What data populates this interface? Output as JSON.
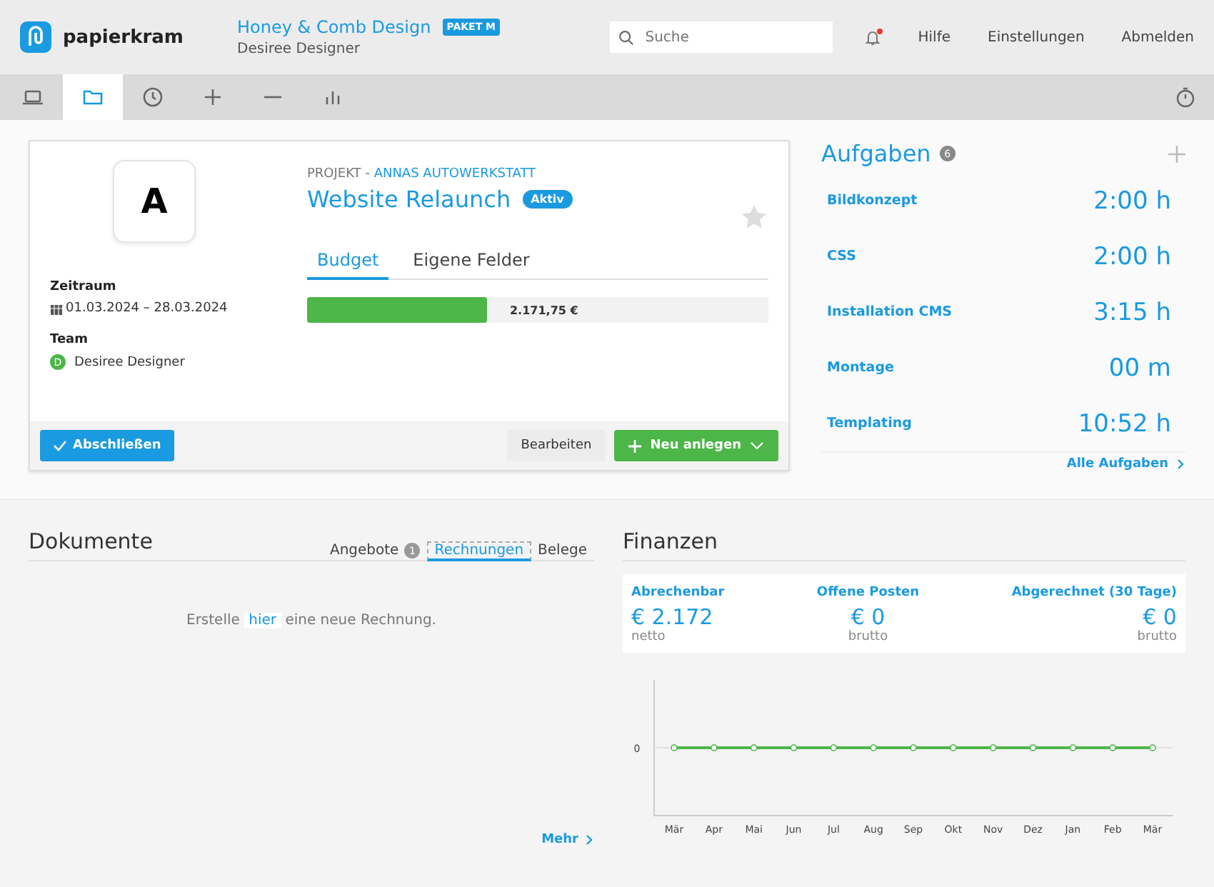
{
  "header": {
    "brand": "papierkram",
    "company": "Honey & Comb Design",
    "plan": "PAKET M",
    "user": "Desiree Designer",
    "search": {
      "placeholder": "Suche"
    },
    "notification": true,
    "links": [
      "Hilfe",
      "Einstellungen",
      "Abmelden"
    ]
  },
  "toolbar": [
    {
      "kind": "laptop",
      "selected": false
    },
    {
      "kind": "folder",
      "selected": true
    },
    {
      "kind": "clock",
      "selected": false
    },
    {
      "kind": "plus",
      "selected": false
    },
    {
      "kind": "minus",
      "selected": false
    },
    {
      "kind": "bars",
      "selected": false
    }
  ],
  "project": {
    "logo_letter": "A",
    "label": "PROJEKT",
    "separator": "-",
    "customer": "ANNAS AUTOWERKSTATT",
    "title": "Website Relaunch",
    "status": "Aktiv",
    "favorite": false,
    "period_label": "Zeitraum",
    "period": "01.03.2024 – 28.03.2024",
    "team_label": "Team",
    "team": [
      {
        "initial": "D",
        "name": "Desiree Designer"
      }
    ],
    "tabs": [
      {
        "label": "Budget",
        "selected": true
      },
      {
        "label": "Eigene Felder",
        "selected": false
      }
    ],
    "budget": {
      "level": 0.39,
      "amount": "2.171,75 €"
    },
    "buttons": {
      "complete": "Abschließen",
      "edit": "Bearbeiten",
      "new": "Neu anlegen"
    }
  },
  "tasks": {
    "title": "Aufgaben",
    "count": "6",
    "items": [
      {
        "name": "Bildkonzept",
        "time": "2:00 h"
      },
      {
        "name": "CSS",
        "time": "2:00 h"
      },
      {
        "name": "Installation CMS",
        "time": "3:15 h"
      },
      {
        "name": "Montage",
        "time": "00 m"
      },
      {
        "name": "Templating",
        "time": "10:52 h"
      }
    ],
    "all_link": "Alle Aufgaben"
  },
  "documents": {
    "title": "Dokumente",
    "tabs": [
      {
        "label": "Angebote",
        "badge": "1",
        "selected": false
      },
      {
        "label": "Rechnungen",
        "selected": true,
        "focused": true
      },
      {
        "label": "Belege",
        "selected": false
      }
    ],
    "empty_before": "Erstelle",
    "empty_link": "hier",
    "empty_after": "eine neue Rechnung.",
    "more": "Mehr"
  },
  "finances": {
    "title": "Finanzen",
    "stats": [
      {
        "label": "Abrechenbar",
        "value": "€ 2.172",
        "note": "netto"
      },
      {
        "label": "Offene Posten",
        "value": "€ 0",
        "note": "brutto"
      },
      {
        "label": "Abgerechnet (30 Tage)",
        "value": "€ 0",
        "note": "brutto"
      }
    ],
    "chart": {
      "months": [
        "Mär",
        "Apr",
        "Mai",
        "Jun",
        "Jul",
        "Aug",
        "Sep",
        "Okt",
        "Nov",
        "Dez",
        "Jan",
        "Feb",
        "Mär"
      ],
      "y_axis_labels": [
        "0"
      ]
    }
  }
}
